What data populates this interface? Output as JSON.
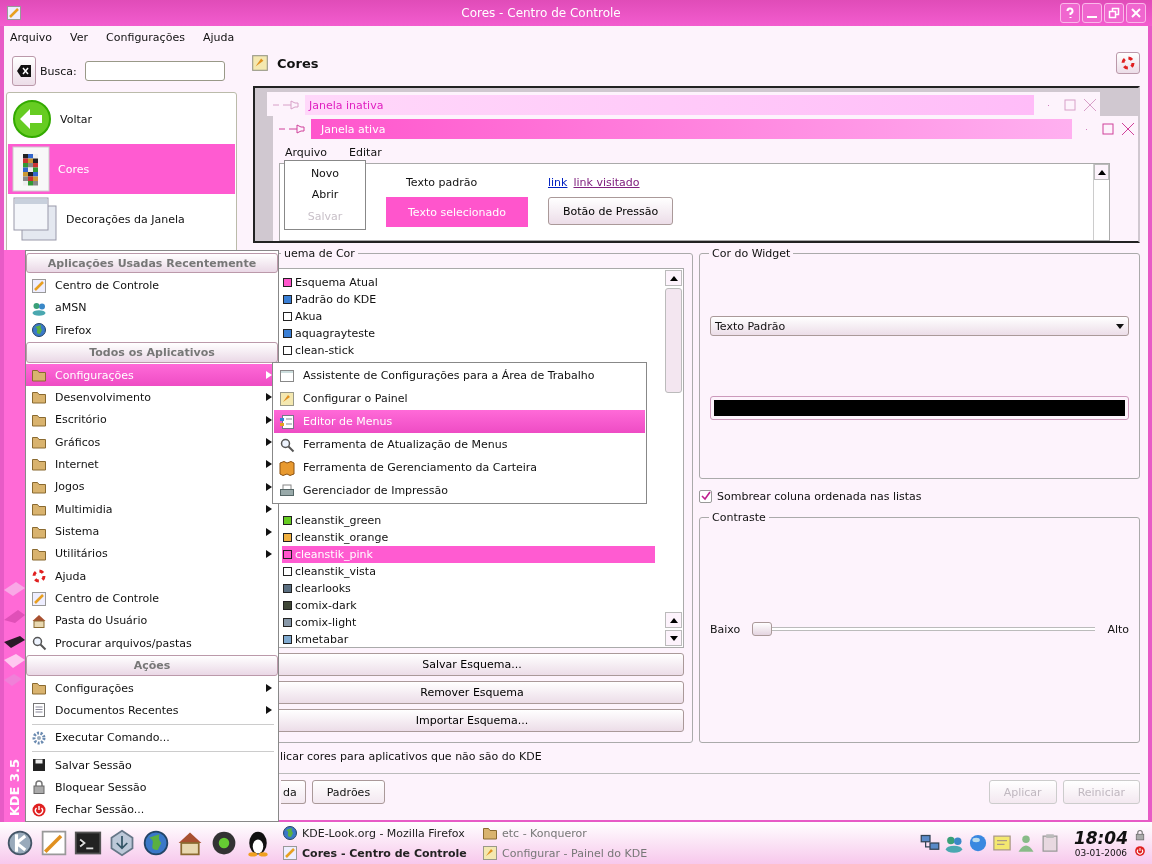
{
  "window": {
    "title": "Cores - Centro de Controle"
  },
  "menubar": [
    "Arquivo",
    "Ver",
    "Configurações",
    "Ajuda"
  ],
  "search": {
    "label": "Busca:"
  },
  "modules": [
    {
      "label": "Voltar",
      "selected": false
    },
    {
      "label": "Cores",
      "selected": true
    },
    {
      "label": "Decorações da Janela",
      "selected": false
    }
  ],
  "header": {
    "title": "Cores"
  },
  "preview": {
    "inactive_title": "Janela inativa",
    "active_title": "Janela ativa",
    "menu": [
      "Arquivo",
      "Editar"
    ],
    "dropdown": [
      {
        "label": "Novo",
        "disabled": false
      },
      {
        "label": "Abrir",
        "disabled": false
      },
      {
        "label": "Salvar",
        "disabled": true
      }
    ],
    "normal_text": "Texto padrão",
    "selected_text": "Texto selecionado",
    "link": "link",
    "visited_link": "link visitado",
    "button": "Botão de Pressão"
  },
  "scheme_group": {
    "legend": "uema de Cor",
    "rows_top": [
      {
        "label": "Esquema Atual",
        "color": "#ff55cc",
        "selected": false
      },
      {
        "label": "Padrão do KDE",
        "color": "#3a7fd5",
        "selected": false
      },
      {
        "label": "Akua",
        "color": "#ffffff",
        "selected": false
      },
      {
        "label": "aquagrayteste",
        "color": "#3a7fd5",
        "selected": false
      },
      {
        "label": "clean-stick",
        "color": "#ffffff",
        "selected": false
      }
    ],
    "rows_bottom": [
      {
        "label": "cleanstik_green",
        "color": "#66cc22",
        "selected": false
      },
      {
        "label": "cleanstik_orange",
        "color": "#f0b040",
        "selected": false
      },
      {
        "label": "cleanstik_pink",
        "color": "#ff55cc",
        "selected": true
      },
      {
        "label": "cleanstik_vista",
        "color": "#ffffff",
        "selected": false
      },
      {
        "label": "clearlooks",
        "color": "#5a6e80",
        "selected": false
      },
      {
        "label": "comix-dark",
        "color": "#404838",
        "selected": false
      },
      {
        "label": "comix-light",
        "color": "#8898a8",
        "selected": false
      },
      {
        "label": "kmetabar",
        "color": "#80aad0",
        "selected": false
      }
    ],
    "buttons": [
      "Salvar Esquema...",
      "Remover Esquema",
      "Importar Esquema..."
    ]
  },
  "widget_color": {
    "legend": "Cor do Widget",
    "selection": "Texto Padrão"
  },
  "shade_checkbox": {
    "label": "Sombrear coluna ordenada nas listas",
    "checked": true
  },
  "contrast": {
    "legend": "Contraste",
    "low": "Baixo",
    "high": "Alto",
    "level": 0
  },
  "apply_others": {
    "label": "licar cores para aplicativos que não são do KDE"
  },
  "buttons": [
    {
      "label": "da",
      "right_aligned": false,
      "disabled": false
    },
    {
      "label": "Padrões",
      "right_aligned": false,
      "disabled": false
    },
    {
      "label": "Aplicar",
      "right_aligned": true,
      "disabled": true
    },
    {
      "label": "Reiniciar",
      "right_aligned": true,
      "disabled": true
    }
  ],
  "kmenu": {
    "side_label": "KDE 3.5",
    "entries": [
      {
        "kind": "header",
        "label": "Aplicações Usadas Recentemente"
      },
      {
        "kind": "item",
        "label": "Centro de Controle",
        "submenu": false,
        "selected": false
      },
      {
        "kind": "item",
        "label": "aMSN",
        "submenu": false,
        "selected": false
      },
      {
        "kind": "item",
        "label": "Firefox",
        "submenu": false,
        "selected": false
      },
      {
        "kind": "header",
        "label": "Todos os Aplicativos"
      },
      {
        "kind": "item",
        "label": "Configurações",
        "submenu": true,
        "selected": true
      },
      {
        "kind": "item",
        "label": "Desenvolvimento",
        "submenu": true,
        "selected": false
      },
      {
        "kind": "item",
        "label": "Escritório",
        "submenu": true,
        "selected": false
      },
      {
        "kind": "item",
        "label": "Gráficos",
        "submenu": true,
        "selected": false
      },
      {
        "kind": "item",
        "label": "Internet",
        "submenu": true,
        "selected": false
      },
      {
        "kind": "item",
        "label": "Jogos",
        "submenu": true,
        "selected": false
      },
      {
        "kind": "item",
        "label": "Multimidia",
        "submenu": true,
        "selected": false
      },
      {
        "kind": "item",
        "label": "Sistema",
        "submenu": true,
        "selected": false
      },
      {
        "kind": "item",
        "label": "Utilitários",
        "submenu": true,
        "selected": false
      },
      {
        "kind": "item",
        "label": "Ajuda",
        "submenu": false,
        "selected": false
      },
      {
        "kind": "item",
        "label": "Centro de Controle",
        "submenu": false,
        "selected": false
      },
      {
        "kind": "item",
        "label": "Pasta do Usuário",
        "submenu": false,
        "selected": false
      },
      {
        "kind": "item",
        "label": "Procurar arquivos/pastas",
        "submenu": false,
        "selected": false
      },
      {
        "kind": "header",
        "label": "Ações"
      },
      {
        "kind": "item",
        "label": "Configurações",
        "submenu": true,
        "selected": false
      },
      {
        "kind": "item",
        "label": "Documentos Recentes",
        "submenu": true,
        "selected": false
      },
      {
        "kind": "separator"
      },
      {
        "kind": "item",
        "label": "Executar Comando...",
        "submenu": false,
        "selected": false
      },
      {
        "kind": "separator"
      },
      {
        "kind": "item",
        "label": "Salvar Sessão",
        "submenu": false,
        "selected": false
      },
      {
        "kind": "item",
        "label": "Bloquear Sessão",
        "submenu": false,
        "selected": false
      },
      {
        "kind": "item",
        "label": "Fechar Sessão...",
        "submenu": false,
        "selected": false
      }
    ]
  },
  "submenu": [
    {
      "label": "Assistente de Configurações para a Área de Trabalho",
      "selected": false
    },
    {
      "label": "Configurar o Painel",
      "selected": false
    },
    {
      "label": "Editor de Menus",
      "selected": true
    },
    {
      "label": "Ferramenta de Atualização de Menus",
      "selected": false
    },
    {
      "label": "Ferramenta de Gerenciamento da Carteira",
      "selected": false
    },
    {
      "label": "Gerenciador de Impressão",
      "selected": false
    }
  ],
  "taskbar": {
    "tasks": [
      {
        "label": "KDE-Look.org - Mozilla Firefox",
        "active": false,
        "minimized": false
      },
      {
        "label": "etc - Konqueror",
        "active": false,
        "minimized": true
      },
      {
        "label": "Cores - Centro de Controle",
        "active": true,
        "minimized": false
      },
      {
        "label": "Configurar - Painel do KDE",
        "active": false,
        "minimized": true
      }
    ],
    "clock": "18:04",
    "date": "03-01-2006"
  }
}
